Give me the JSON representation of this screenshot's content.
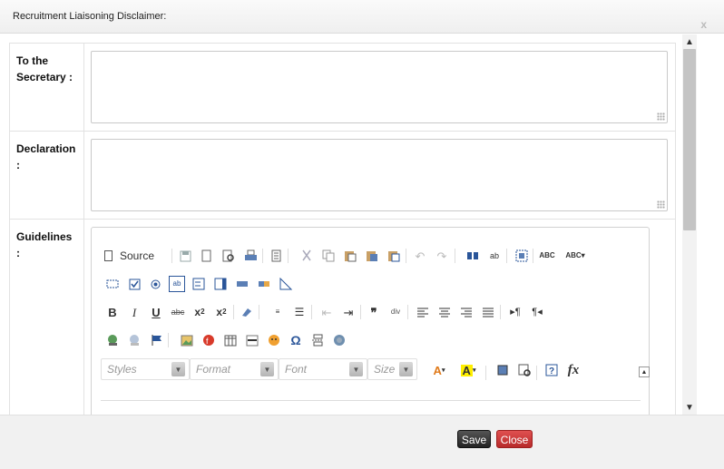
{
  "dialog": {
    "title": "Recruitment Liaisoning Disclaimer:",
    "close_glyph": "x"
  },
  "form": {
    "rows": [
      {
        "label": "To the Secretary :",
        "value": ""
      },
      {
        "label": "Declaration :",
        "value": ""
      },
      {
        "label": "Guidelines :"
      }
    ]
  },
  "editor": {
    "source_label": "Source",
    "combos": [
      {
        "label": "Styles"
      },
      {
        "label": "Format"
      },
      {
        "label": "Font"
      },
      {
        "label": "Size"
      }
    ],
    "toolbar_icons": [
      "source-icon",
      "save-icon",
      "new-page-icon",
      "preview-icon",
      "print-icon",
      "templates-icon",
      "cut-icon",
      "copy-icon",
      "paste-icon",
      "paste-text-icon",
      "paste-word-icon",
      "undo-icon",
      "redo-icon",
      "find-icon",
      "replace-icon",
      "select-all-icon",
      "spellcheck-icon",
      "spell-as-you-type-icon",
      "form-icon",
      "checkbox-icon",
      "radio-icon",
      "textfield-icon",
      "textarea-icon",
      "select-icon",
      "button-icon",
      "image-button-icon",
      "hidden-field-icon",
      "bold-icon",
      "italic-icon",
      "underline-icon",
      "strike-icon",
      "subscript-icon",
      "superscript-icon",
      "remove-format-icon",
      "numbered-list-icon",
      "bulleted-list-icon",
      "outdent-icon",
      "indent-icon",
      "blockquote-icon",
      "create-div-icon",
      "align-left-icon",
      "align-center-icon",
      "align-right-icon",
      "justify-icon",
      "ltr-icon",
      "rtl-icon",
      "link-icon",
      "unlink-icon",
      "anchor-icon",
      "image-icon",
      "flash-icon",
      "table-icon",
      "horizontal-rule-icon",
      "smiley-icon",
      "special-char-icon",
      "page-break-icon",
      "iframe-icon",
      "text-color-icon",
      "bg-color-icon",
      "maximize-icon",
      "show-blocks-icon",
      "about-icon",
      "math-icon",
      "toolbar-collapse-icon"
    ]
  },
  "footer": {
    "save_label": "Save",
    "close_label": "Close"
  },
  "colors": {
    "save_button": "#333333",
    "close_button": "#cc3b3b"
  }
}
